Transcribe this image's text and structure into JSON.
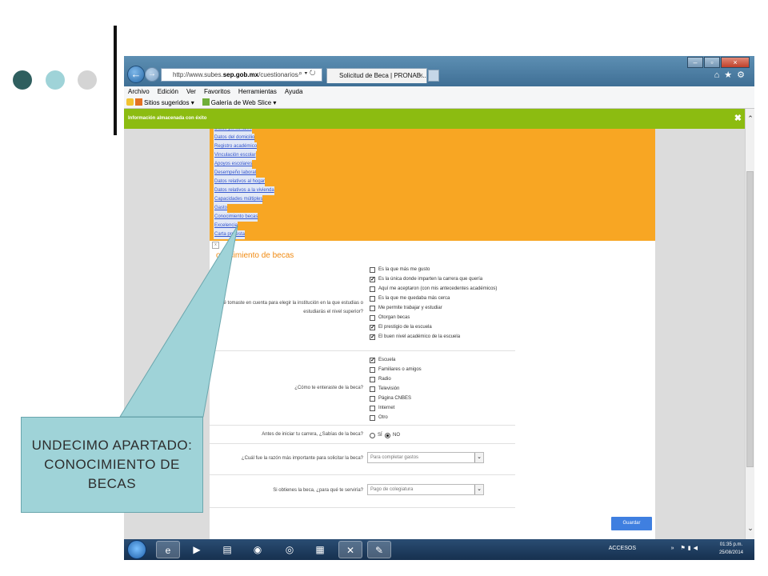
{
  "browser": {
    "address": "http://www.subes.sep.gob.mx/cuestionarios/Cue",
    "address_host": "sep.gob.mx",
    "address_prefix": "http://www.subes.",
    "address_suffix": "/cuestionarios/Cue",
    "tab_title": "Solicitud de Beca | PRONAB...",
    "menu": [
      "Archivo",
      "Edición",
      "Ver",
      "Favoritos",
      "Herramientas",
      "Ayuda"
    ],
    "favorites": [
      "Sitios sugeridos ▾",
      "Galería de Web Slice ▾"
    ]
  },
  "notification": {
    "text": "Información almacenada con éxito"
  },
  "page": {
    "menu_items": [
      "Datos personales",
      "Datos del domicilio",
      "Registro académico",
      "Vinculación escolar",
      "Apoyos escolares",
      "Desempeño laboral",
      "Datos relativos al hogar",
      "Datos relativos a la vivienda",
      "Capacidades múltiples",
      "Gasto",
      "Conocimiento becas",
      "Excelencia",
      "Carta protesta"
    ],
    "section_title": "onocimiento de becas",
    "q1": {
      "label": "¿Qué tomaste en cuenta para elegir la institución en la que estudias o estudiarás el nivel superior?",
      "options": [
        {
          "text": "Es la que más me gusto",
          "checked": false
        },
        {
          "text": "Es la única donde imparten la carrera que quería",
          "checked": true
        },
        {
          "text": "Aquí me aceptaron (con mis antecedentes académicos)",
          "checked": false
        },
        {
          "text": "Es la que me quedaba más cerca",
          "checked": false
        },
        {
          "text": "Me permite trabajar y estudiar",
          "checked": false
        },
        {
          "text": "Otorgan becas",
          "checked": false
        },
        {
          "text": "El prestigio de la escuela",
          "checked": true
        },
        {
          "text": "El buen nivel académico de la escuela",
          "checked": true
        }
      ]
    },
    "q2": {
      "label": "¿Cómo te enteraste de la beca?",
      "options": [
        {
          "text": "Escuela",
          "checked": true
        },
        {
          "text": "Familiares o amigos",
          "checked": false
        },
        {
          "text": "Radio",
          "checked": false
        },
        {
          "text": "Televisión",
          "checked": false
        },
        {
          "text": "Página CNBES",
          "checked": false
        },
        {
          "text": "Internet",
          "checked": false
        },
        {
          "text": "Otro",
          "checked": false
        }
      ]
    },
    "q3": {
      "label": "Antes de iniciar tu carrera, ¿Sabías de la beca?",
      "yes": "SÍ",
      "no": "NO",
      "selected": "NO"
    },
    "q4": {
      "label": "¿Cuál fue la razón más importante para solicitar la beca?",
      "value": "Para completar gastos"
    },
    "q5": {
      "label": "Si obtienes la beca, ¿para qué te serviría?",
      "value": "Pago de colegiatura"
    },
    "save_label": "Guardar"
  },
  "taskbar": {
    "tray_label": "ACCESOS",
    "time": "01:35 p.m.",
    "date": "25/08/2014"
  },
  "callout": {
    "text": "UNDECIMO APARTADO: CONOCIMIENTO DE BECAS"
  },
  "colors": {
    "accent_orange": "#f8a623",
    "notification_green": "#8cbc11",
    "callout_teal": "#9fd3d8",
    "button_blue": "#3f7fe0"
  }
}
